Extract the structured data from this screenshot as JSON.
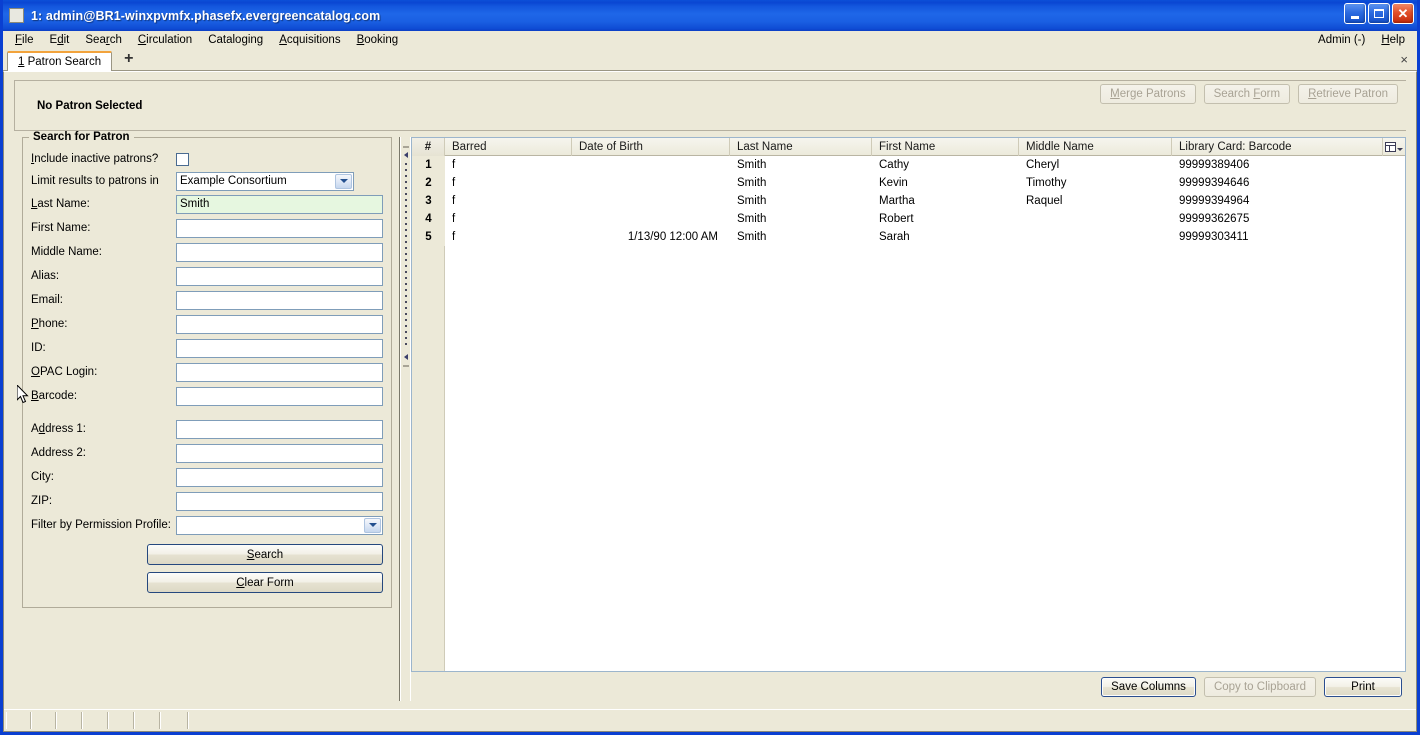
{
  "window": {
    "title": "1: admin@BR1-winxpvmfx.phasefx.evergreencatalog.com",
    "minimize_label": "",
    "maximize_label": "",
    "close_label": "✕"
  },
  "menubar": {
    "items": [
      {
        "label": "File",
        "accel": "F"
      },
      {
        "label": "Edit",
        "accel": "E"
      },
      {
        "label": "Search",
        "accel": "r"
      },
      {
        "label": "Circulation",
        "accel": "C"
      },
      {
        "label": "Cataloging",
        "accel": "g"
      },
      {
        "label": "Acquisitions",
        "accel": "A"
      },
      {
        "label": "Booking",
        "accel": "B"
      }
    ],
    "right_items": [
      {
        "label": "Admin (-)"
      },
      {
        "label": "Help"
      }
    ]
  },
  "tabs": {
    "items": [
      {
        "label": "1 Patron Search",
        "index": "1"
      }
    ],
    "add_label": "+",
    "close_label": "×"
  },
  "patron_bar": {
    "status": "No Patron Selected",
    "actions": [
      {
        "label": "Merge Patrons",
        "enabled": false
      },
      {
        "label": "Search Form",
        "enabled": false
      },
      {
        "label": "Retrieve Patron",
        "enabled": false
      }
    ]
  },
  "search_form": {
    "legend": "Search for Patron",
    "include_inactive_label": "Include inactive patrons?",
    "include_inactive_checked": false,
    "limit_results_label": "Limit results to patrons in",
    "limit_results_value": "Example Consortium",
    "fields": [
      {
        "label": "Last Name:",
        "value": "Smith",
        "focused": true
      },
      {
        "label": "First Name:",
        "value": "",
        "focused": false
      },
      {
        "label": "Middle Name:",
        "value": "",
        "focused": false
      },
      {
        "label": "Alias:",
        "value": "",
        "focused": false
      },
      {
        "label": "Email:",
        "value": "",
        "focused": false
      },
      {
        "label": "Phone:",
        "value": "",
        "focused": false
      },
      {
        "label": "ID:",
        "value": "",
        "focused": false
      },
      {
        "label": "OPAC Login:",
        "value": "",
        "focused": false
      },
      {
        "label": "Barcode:",
        "value": "",
        "focused": false
      }
    ],
    "address_fields": [
      {
        "label": "Address 1:",
        "value": ""
      },
      {
        "label": "Address 2:",
        "value": ""
      },
      {
        "label": "City:",
        "value": ""
      },
      {
        "label": "ZIP:",
        "value": ""
      }
    ],
    "permission_profile_label": "Filter by Permission Profile:",
    "permission_profile_value": "",
    "search_button": "Search",
    "clear_button": "Clear Form"
  },
  "results": {
    "columns": [
      {
        "key": "num",
        "label": "#"
      },
      {
        "key": "barred",
        "label": "Barred"
      },
      {
        "key": "dob",
        "label": "Date of Birth"
      },
      {
        "key": "last",
        "label": "Last Name"
      },
      {
        "key": "first",
        "label": "First Name"
      },
      {
        "key": "middle",
        "label": "Middle Name"
      },
      {
        "key": "barcode",
        "label": "Library Card: Barcode"
      }
    ],
    "rows": [
      {
        "num": "1",
        "barred": "f",
        "dob": "",
        "last": "Smith",
        "first": "Cathy",
        "middle": "Cheryl",
        "barcode": "99999389406"
      },
      {
        "num": "2",
        "barred": "f",
        "dob": "",
        "last": "Smith",
        "first": "Kevin",
        "middle": "Timothy",
        "barcode": "99999394646"
      },
      {
        "num": "3",
        "barred": "f",
        "dob": "",
        "last": "Smith",
        "first": "Martha",
        "middle": "Raquel",
        "barcode": "99999394964"
      },
      {
        "num": "4",
        "barred": "f",
        "dob": "",
        "last": "Smith",
        "first": "Robert",
        "middle": "",
        "barcode": "99999362675"
      },
      {
        "num": "5",
        "barred": "f",
        "dob": "1/13/90 12:00 AM",
        "last": "Smith",
        "first": "Sarah",
        "middle": "",
        "barcode": "99999303411"
      }
    ],
    "footer_buttons": [
      {
        "label": "Save Columns",
        "enabled": true
      },
      {
        "label": "Copy to Clipboard",
        "enabled": false
      },
      {
        "label": "Print",
        "enabled": true
      }
    ]
  },
  "colors": {
    "title_blue": "#0a3fd1",
    "chrome": "#ece9d8",
    "focused_field": "#e6f7e0",
    "tab_accent": "#f2a33c",
    "field_border": "#7f9db9"
  }
}
